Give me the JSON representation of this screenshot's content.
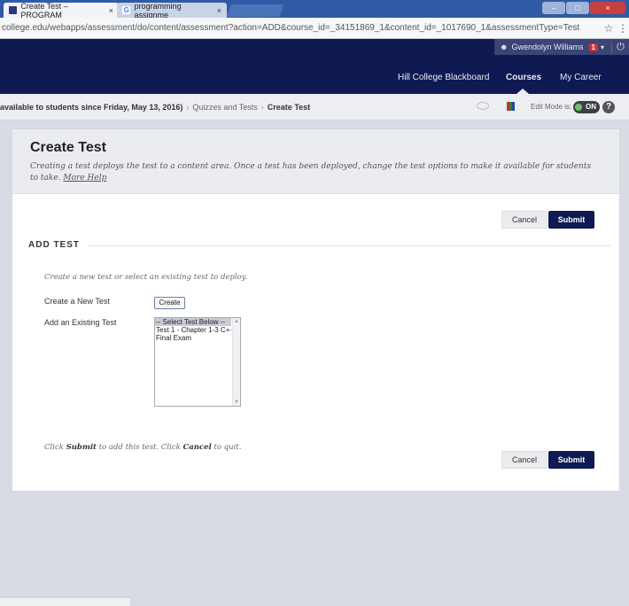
{
  "browser": {
    "tabs": [
      {
        "label": "Create Test – PROGRAM",
        "close": "×"
      },
      {
        "label": "programming assignme",
        "close": "×"
      }
    ],
    "url": "college.edu/webapps/assessment/do/content/assessment?action=ADD&course_id=_34151869_1&content_id=_1017690_1&assessmentType=Test",
    "star": "☆",
    "menu": "⋮"
  },
  "header": {
    "user_name": "Gwendolyn Williams",
    "notification_count": "1",
    "nav": {
      "hill": "Hill College Blackboard",
      "courses": "Courses",
      "career": "My Career"
    }
  },
  "breadcrumb": {
    "course": "available to students since Friday, May 13, 2016)",
    "sep1": "›",
    "folder": "Quizzes and Tests",
    "sep2": "›",
    "current": "Create Test",
    "edit_mode_label": "Edit Mode is:",
    "edit_mode_value": "ON",
    "help": "?"
  },
  "page": {
    "title": "Create Test",
    "description": "Creating a test deploys the test to a content area. Once a test has been deployed, change the test options to make it available for students to take.",
    "more_help": "More Help"
  },
  "buttons": {
    "cancel": "Cancel",
    "submit": "Submit",
    "create": "Create"
  },
  "form": {
    "section_title": "ADD TEST",
    "instructions": "Create a new test or select an existing test to deploy.",
    "new_test_label": "Create a New Test",
    "existing_test_label": "Add an Existing Test",
    "existing_tests": [
      "-- Select Test Below --",
      "Test 1 - Chapter 1-3 C++",
      "Final Exam"
    ]
  },
  "footer": {
    "click": "Click",
    "submit_word": "Submit",
    "middle": "to add this test. Click",
    "cancel_word": "Cancel",
    "end": "to quit."
  },
  "colors": {
    "header_navy": "#0f1952",
    "tab_strip_blue": "#2f5aa6",
    "toggle_green": "#6fc36b",
    "badge_red": "#d3312f"
  }
}
